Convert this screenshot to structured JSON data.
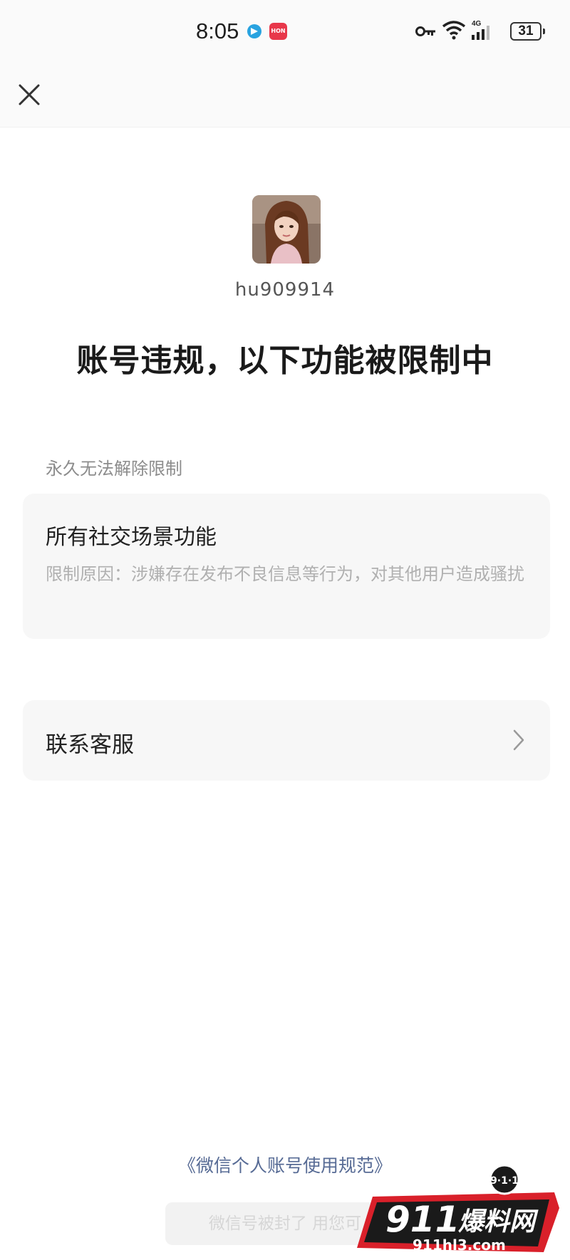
{
  "status_bar": {
    "time": "8:05",
    "network": "4G",
    "battery": "31",
    "app_badge": "HON"
  },
  "nav": {
    "close_icon": "close-icon"
  },
  "profile": {
    "avatar": "avatar-photo",
    "username": "hu909914"
  },
  "headline": "账号违规，以下功能被限制中",
  "section_label": "永久无法解除限制",
  "restriction": {
    "title": "所有社交场景功能",
    "reason": "限制原因：涉嫌存在发布不良信息等行为，对其他用户造成骚扰"
  },
  "contact": {
    "label": "联系客服",
    "icon": "chevron-right-icon"
  },
  "footer": {
    "policy_link": "《微信个人账号使用规范》",
    "button_label": "微信号被封了 用您可"
  },
  "watermark": {
    "badge": "9·1·1",
    "brand": "911",
    "brand_cn": "爆料网",
    "url": "911hl3.com"
  },
  "colors": {
    "link": "#576b95",
    "card_bg": "#f7f7f7",
    "muted_text": "#b0b0b0",
    "watermark_red": "#d9202a"
  }
}
